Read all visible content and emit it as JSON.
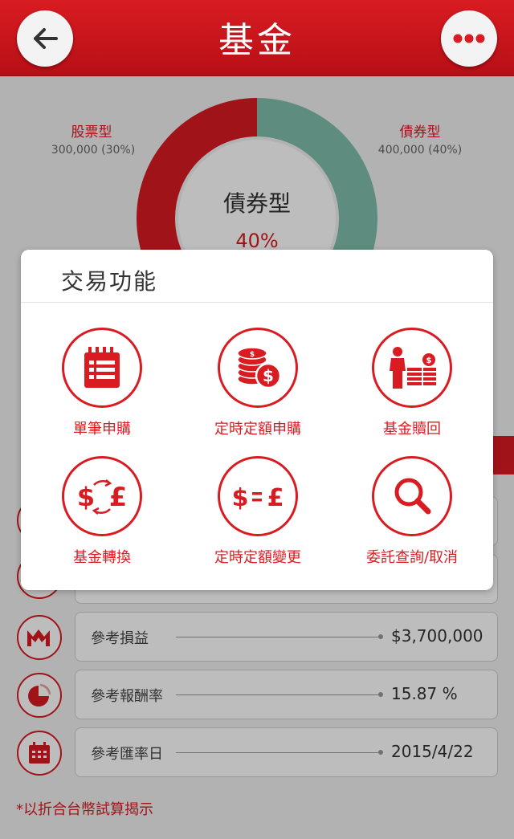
{
  "header": {
    "title": "基金"
  },
  "allocation": {
    "segments": [
      {
        "name": "股票型",
        "amount_text": "300,000 (30%)",
        "percent": 30,
        "color": "#d81c22"
      },
      {
        "name": "債券型",
        "amount_text": "400,000 (40%)",
        "percent": 40,
        "color": "#7fbfad"
      }
    ],
    "selected": {
      "name": "債券型",
      "percent_text": "40%"
    }
  },
  "rows": [
    {
      "icon": "bar-chart-icon",
      "label": "參考損益",
      "value": "$3,700,000"
    },
    {
      "icon": "pie-chart-icon",
      "label": "參考報酬率",
      "value": "15.87 %"
    },
    {
      "icon": "calendar-icon",
      "label": "參考匯率日",
      "value": "2015/4/22"
    }
  ],
  "footnote": "*以折合台幣試算揭示",
  "dialog": {
    "title": "交易功能",
    "functions": [
      {
        "label": "單筆申購",
        "icon": "calendar-icon"
      },
      {
        "label": "定時定額申購",
        "icon": "coins-icon"
      },
      {
        "label": "基金贖回",
        "icon": "person-coins-icon"
      },
      {
        "label": "基金轉換",
        "icon": "currency-exchange-icon"
      },
      {
        "label": "定時定額變更",
        "icon": "currency-equal-icon"
      },
      {
        "label": "委託查詢/取消",
        "icon": "search-icon"
      }
    ]
  },
  "colors": {
    "accent": "#d81c22",
    "bond": "#7fbfad"
  }
}
